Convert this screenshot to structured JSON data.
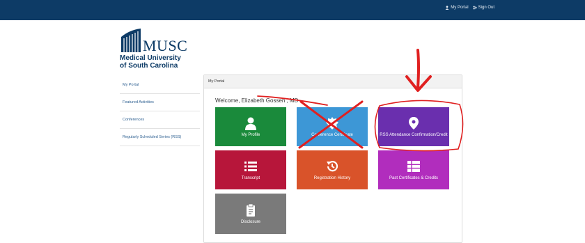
{
  "topbar": {
    "my_portal": "My Portal",
    "sign_out": "Sign Out"
  },
  "logo": {
    "word": "MUSC",
    "line1": "Medical University",
    "line2": "of South Carolina"
  },
  "sidebar": {
    "items": [
      {
        "label": "My Portal"
      },
      {
        "label": "Featured Activities"
      },
      {
        "label": "Conferences"
      },
      {
        "label": "Regularly Scheduled Series (RSS)"
      }
    ]
  },
  "panel": {
    "title": "My Portal",
    "welcome": "Welcome, Elizabeth Gossen , MD"
  },
  "tiles": {
    "profile": "My Profile",
    "cert": "Conference Certificate",
    "rss": "RSS Attendance Confirmation/Credit",
    "transcript": "Transcript",
    "history": "Registration History",
    "past": "Past Certificates & Credits",
    "disclosure": "Disclosure"
  },
  "colors": {
    "topbar": "#0d3b66",
    "green": "#1a8a3b",
    "blue": "#3d97d6",
    "purple": "#6a2fae",
    "crimson": "#b7163a",
    "orange": "#d9532a",
    "magenta": "#b12dbd",
    "gray": "#7a7a7a",
    "annotation": "#e02020"
  },
  "icons": [
    "user-icon",
    "sign-out-icon",
    "person-icon",
    "badge-icon",
    "map-pin-icon",
    "list-icon",
    "history-icon",
    "grid-list-icon",
    "clipboard-icon"
  ]
}
